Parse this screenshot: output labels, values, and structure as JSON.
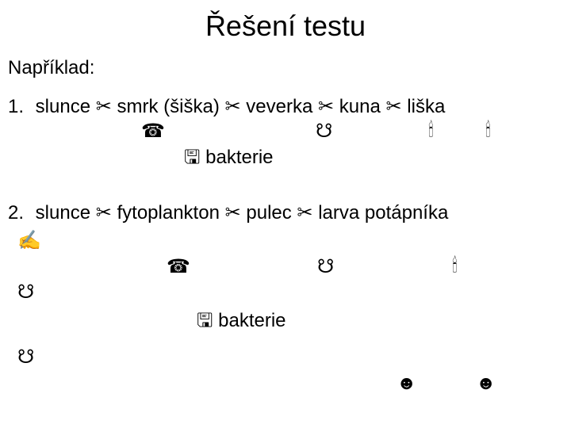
{
  "title": "Řešení testu",
  "example_label": "Například:",
  "chain1": {
    "num": "1.",
    "w1": "slunce",
    "w2": "smrk (šiška)",
    "w3": "veverka",
    "w4": "kuna",
    "w5": "liška"
  },
  "chain2": {
    "num": "2.",
    "w1": "slunce",
    "w2": "fytoplankton",
    "w3": "pulec",
    "w4": "larva potápníka"
  },
  "arrow": "✂",
  "bakterie_icon": "🖫",
  "bakterie_label": "bakterie",
  "sym": {
    "phone": "☎",
    "wave": "☋",
    "drop": "🕯",
    "write": "✍",
    "face": "☻"
  }
}
